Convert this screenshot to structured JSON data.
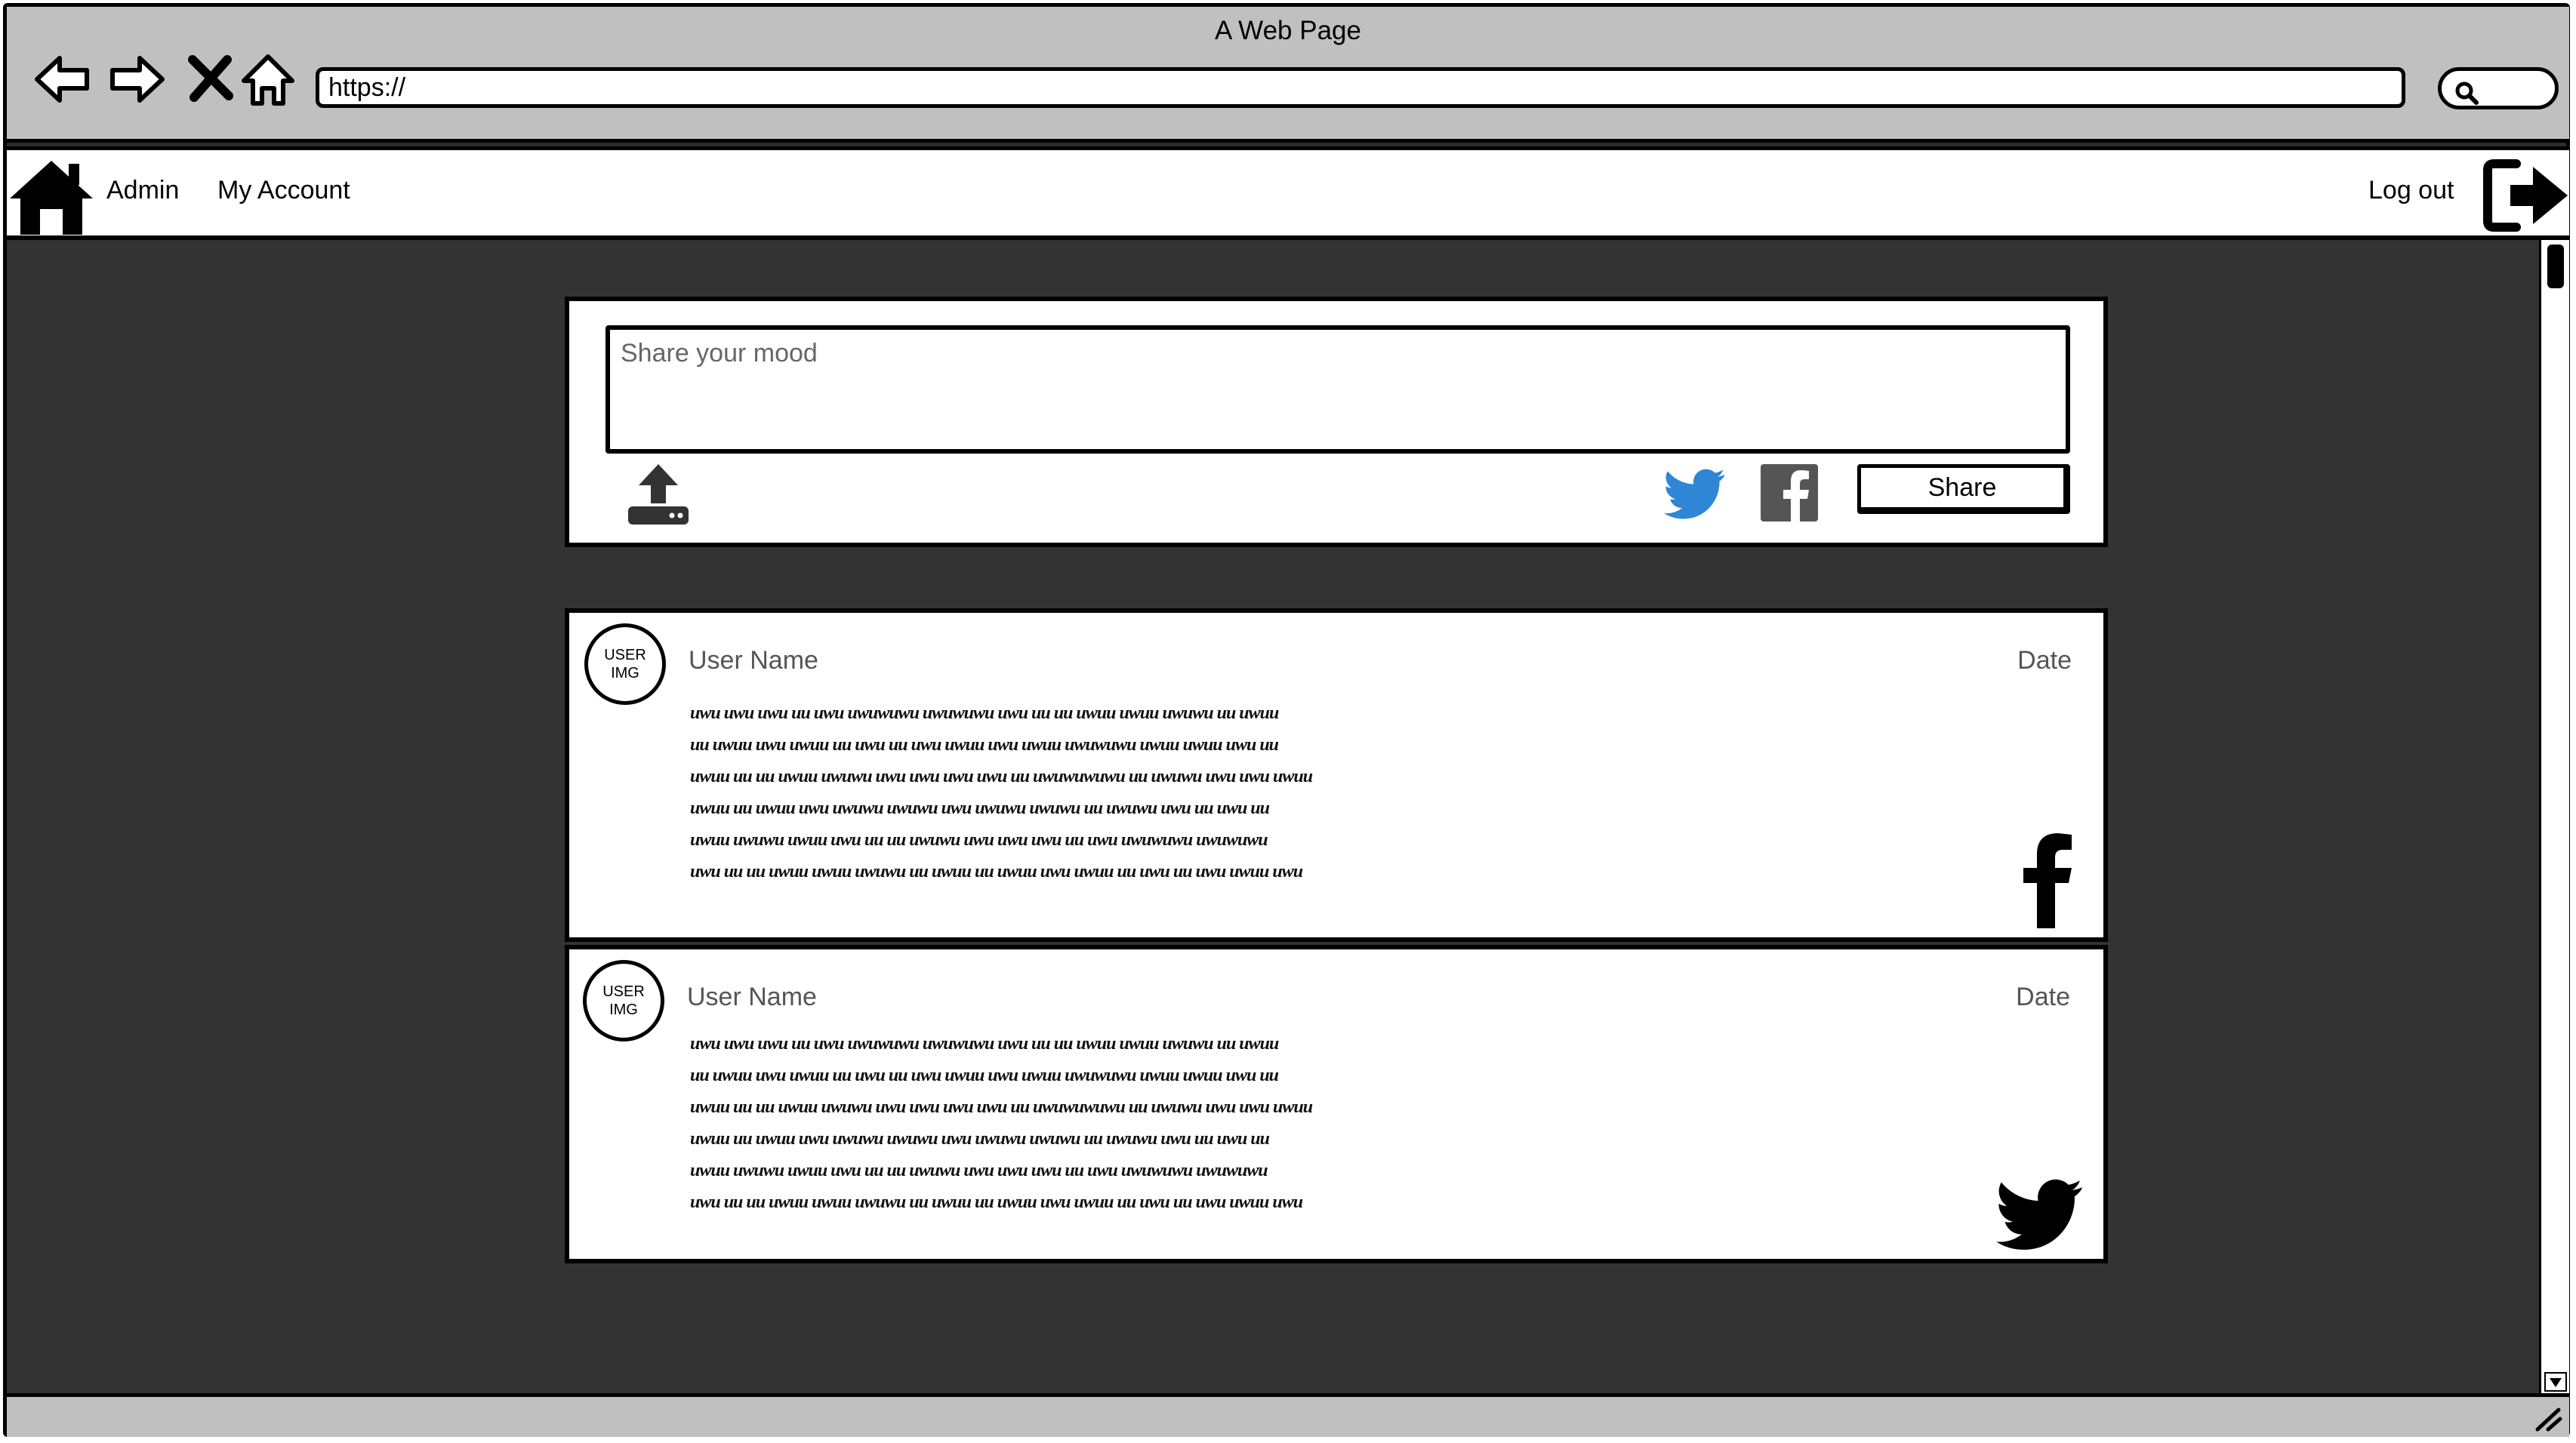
{
  "window": {
    "title": "A Web Page",
    "url": "https://"
  },
  "navbar": {
    "admin_label": "Admin",
    "account_label": "My Account",
    "logout_label": "Log out"
  },
  "composer": {
    "placeholder": "Share your mood",
    "share_label": "Share"
  },
  "posts": [
    {
      "avatar_label": "USER\nIMG",
      "user_name": "User Name",
      "date": "Date",
      "network_icon": "facebook-icon",
      "body_lines": [
        "uwu uwu uwu uu uwu uwuwuwu uwuwuwu uwu uu uu uwuu uwuu uwuwu uu uwuu",
        "uu uwuu uwu uwuu uu uwu uu uwu uwuu uwu uwuu uwuwuwu uwuu uwuu uwu uu",
        "uwuu uu uu uwuu uwuwu uwu uwu uwu uwu uu uwuwuwuwu uu uwuwu uwu uwu uwuu",
        "uwuu uu uwuu uwu uwuwu uwuwu uwu uwuwu uwuwu uu uwuwu uwu uu uwu uu",
        "uwuu uwuwu uwuu uwu uu uu uwuwu uwu uwu uwu uu uwu uwuwuwu uwuwuwu",
        "uwu uu uu uwuu uwuu uwuwu uu uwuu uu uwuu uwu uwuu uu uwu uu uwu uwuu uwu"
      ]
    },
    {
      "avatar_label": "USER\nIMG",
      "user_name": "User Name",
      "date": "Date",
      "network_icon": "twitter-icon",
      "body_lines": [
        "uwu uwu uwu uu uwu uwuwuwu uwuwuwu uwu uu uu uwuu uwuu uwuwu uu uwuu",
        "uu uwuu uwu uwuu uu uwu uu uwu uwuu uwu uwuu uwuwuwu uwuu uwuu uwu uu",
        "uwuu uu uu uwuu uwuwu uwu uwu uwu uwu uu uwuwuwuwu uu uwuwu uwu uwu uwuu",
        "uwuu uu uwuu uwu uwuwu uwuwu uwu uwuwu uwuwu uu uwuwu uwu uu uwu uu",
        "uwuu uwuwu uwuu uwu uu uu uwuwu uwu uwu uwu uu uwu uwuwuwu uwuwuwu",
        "uwu uu uu uwuu uwuu uwuwu uu uwuu uu uwuu uwu uwuu uu uwu uu uwu uwuu uwu"
      ]
    }
  ],
  "colors": {
    "content_bg": "#333333",
    "chrome_bg": "#c0c0c0",
    "twitter_blue": "#2f86d6",
    "facebook_gray": "#555555"
  }
}
